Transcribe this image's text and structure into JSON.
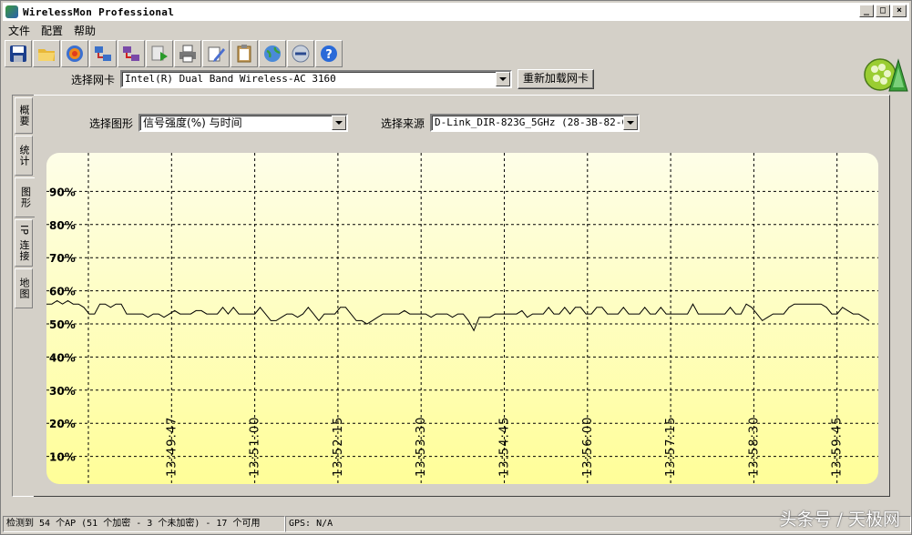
{
  "window": {
    "title": "WirelessMon Professional",
    "buttons": [
      "_",
      "□",
      "×"
    ]
  },
  "menu": [
    "文件",
    "配置",
    "帮助"
  ],
  "toolbar": {
    "icons": [
      "save-icon",
      "open-folder-icon",
      "record-icon",
      "network-icon",
      "network-stop-icon",
      "play-icon",
      "printer-icon",
      "settings-icon",
      "clipboard-icon",
      "globe-icon",
      "connect-icon",
      "help-icon"
    ]
  },
  "adapter": {
    "label": "选择网卡",
    "value": "Intel(R) Dual Band Wireless-AC 3160",
    "reload_button": "重新加载网卡"
  },
  "tabs": [
    {
      "label": "概要",
      "active": false
    },
    {
      "label": "统计",
      "active": false
    },
    {
      "label": "图形",
      "active": true
    },
    {
      "label": "IP 连接",
      "active": false
    },
    {
      "label": "地图",
      "active": false
    }
  ],
  "graph_select": {
    "label": "选择图形",
    "value": "信号强度(%) 与时间"
  },
  "source_select": {
    "label": "选择来源",
    "value": "D-Link_DIR-823G_5GHz (28-3B-82-C4-6"
  },
  "chart_data": {
    "type": "line",
    "ylim": [
      0,
      100
    ],
    "y_ticks": [
      "90%",
      "80%",
      "70%",
      "60%",
      "50%",
      "40%",
      "30%",
      "20%",
      "10%"
    ],
    "x_ticks": [
      "13:49:47",
      "13:51:00",
      "13:52:15",
      "13:53:30",
      "13:54:45",
      "13:56:00",
      "13:57:15",
      "13:58:30",
      "13:59:45"
    ],
    "grid": true,
    "series": [
      {
        "values": [
          56,
          56,
          57,
          56,
          57,
          56,
          56,
          55,
          53,
          53,
          56,
          56,
          55,
          56,
          56,
          53,
          53,
          53,
          53,
          52,
          53,
          53,
          52,
          53,
          54,
          53,
          53,
          53,
          54,
          54,
          53,
          53,
          53,
          55,
          53,
          55,
          53,
          53,
          53,
          53,
          55,
          53,
          51,
          51,
          52,
          53,
          53,
          52,
          53,
          55,
          53,
          51,
          53,
          53,
          53,
          55,
          55,
          53,
          51,
          51,
          50,
          51,
          52,
          53,
          53,
          53,
          53,
          54,
          53,
          53,
          53,
          53,
          52,
          53,
          53,
          53,
          52,
          53,
          53,
          51,
          48,
          52,
          52,
          52,
          53,
          53,
          53,
          53,
          53,
          54,
          52,
          53,
          53,
          53,
          55,
          53,
          53,
          55,
          53,
          55,
          55,
          53,
          53,
          55,
          55,
          53,
          53,
          53,
          55,
          53,
          53,
          53,
          55,
          53,
          53,
          55,
          53,
          53,
          53,
          53,
          53,
          56,
          53,
          53,
          53,
          53,
          53,
          53,
          55,
          53,
          53,
          56,
          55,
          53,
          51,
          52,
          53,
          53,
          53,
          55,
          56,
          56,
          56,
          56,
          56,
          56,
          55,
          53,
          53,
          55,
          54,
          53,
          53,
          52,
          51
        ],
        "color": "#000000"
      }
    ]
  },
  "status": {
    "ap_count": "检测到 54 个AP (51 个加密 - 3 个未加密) - 17 个可用",
    "gps": "GPS: N/A"
  },
  "watermark": "头条号 / 天极网"
}
